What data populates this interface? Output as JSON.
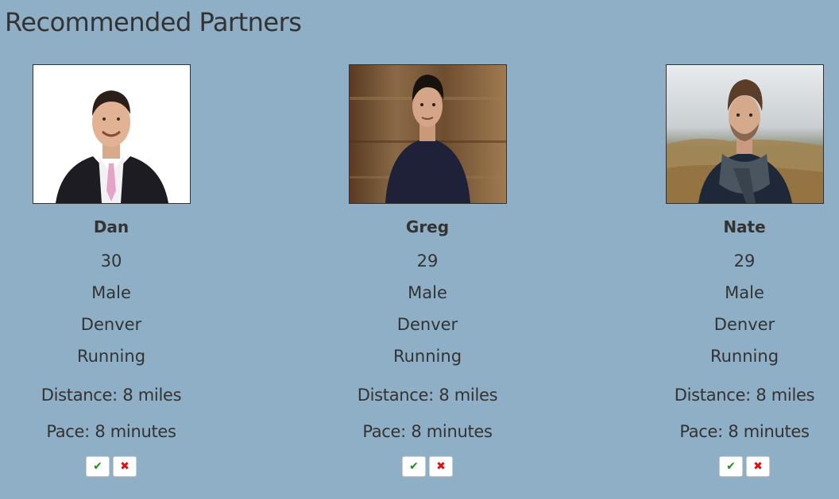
{
  "page": {
    "title": "Recommended Partners"
  },
  "colors": {
    "background": "#8eafc6",
    "text": "#333333",
    "accept": "#1e8c1e",
    "reject": "#dd1111"
  },
  "partners": [
    {
      "name": "Dan",
      "age": "30",
      "gender": "Male",
      "city": "Denver",
      "activity": "Running",
      "distance": "Distance: 8 miles",
      "pace": "Pace: 8 minutes",
      "photo": "man-in-suit-photo"
    },
    {
      "name": "Greg",
      "age": "29",
      "gender": "Male",
      "city": "Denver",
      "activity": "Running",
      "distance": "Distance: 8 miles",
      "pace": "Pace: 8 minutes",
      "photo": "man-dark-sweater-photo"
    },
    {
      "name": "Nate",
      "age": "29",
      "gender": "Male",
      "city": "Denver",
      "activity": "Running",
      "distance": "Distance: 8 miles",
      "pace": "Pace: 8 minutes",
      "photo": "man-with-scarf-photo"
    }
  ],
  "actions": {
    "accept_icon": "check-icon",
    "reject_icon": "x-icon",
    "accept_glyph": "✔",
    "reject_glyph": "✖"
  }
}
